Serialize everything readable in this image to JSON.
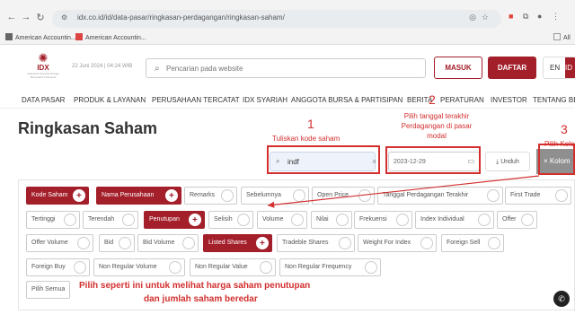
{
  "browser": {
    "url": "idx.co.id/id/data-pasar/ringkasan-perdagangan/ringkasan-saham/",
    "bookmarks": [
      "American Accountin...",
      "American Accountin..."
    ],
    "all_bookmarks": "All"
  },
  "header": {
    "logo_text": "IDX",
    "logo_sub": "Indonesia Stock Exchange Bursa Efek Indonesia",
    "date": "22 Juni 2024",
    "time": "04:24 WIB",
    "search_placeholder": "Pencarian pada website",
    "masuk": "MASUK",
    "daftar": "DAFTAR",
    "lang_en": "EN",
    "lang_id": "ID"
  },
  "nav": [
    "DATA PASAR",
    "PRODUK & LAYANAN",
    "PERUSAHAAN TERCATAT",
    "IDX SYARIAH",
    "ANGGOTA BURSA & PARTISIPAN",
    "BERITA",
    "PERATURAN",
    "INVESTOR",
    "TENTANG BEI"
  ],
  "page_title": "Ringkasan Saham",
  "annotations": {
    "n1": "1",
    "n1_text": "Tuliskan kode saham",
    "n2": "2",
    "n2_text_1": "Pilih tanggal terakhir",
    "n2_text_2": "Perdagangan di pasar",
    "n2_text_3": "modal",
    "n3": "3",
    "n3_text": "Pilih Kolom",
    "bottom_1": "Pilih seperti ini untuk melihat harga saham penutupan",
    "bottom_2": "dan jumlah saham beredar"
  },
  "filters": {
    "code_value": "indf",
    "date_value": "2023-12-29",
    "unduh": "Unduh",
    "kolom": "Kolom"
  },
  "columns": [
    {
      "label": "Kode Saham",
      "selected": true
    },
    {
      "label": "Nama Perusahaan",
      "selected": true
    },
    {
      "label": "Remarks",
      "selected": false
    },
    {
      "label": "Sebelumnya",
      "selected": false
    },
    {
      "label": "Open Price",
      "selected": false
    },
    {
      "label": "Tanggal Perdagangan Terakhir",
      "selected": false
    },
    {
      "label": "First Trade",
      "selected": false
    },
    {
      "label": "Tertinggi",
      "selected": false
    },
    {
      "label": "Terendah",
      "selected": false
    },
    {
      "label": "Penutupan",
      "selected": true
    },
    {
      "label": "Selisih",
      "selected": false
    },
    {
      "label": "Volume",
      "selected": false
    },
    {
      "label": "Nilai",
      "selected": false
    },
    {
      "label": "Frekuensi",
      "selected": false
    },
    {
      "label": "Index Individual",
      "selected": false
    },
    {
      "label": "Offer",
      "selected": false
    },
    {
      "label": "Offer Volume",
      "selected": false
    },
    {
      "label": "Bid",
      "selected": false
    },
    {
      "label": "Bid Volume",
      "selected": false
    },
    {
      "label": "Listed Shares",
      "selected": true
    },
    {
      "label": "Tradeble Shares",
      "selected": false
    },
    {
      "label": "Weight For Index",
      "selected": false
    },
    {
      "label": "Foreign Sell",
      "selected": false
    },
    {
      "label": "Foreign Buy",
      "selected": false
    },
    {
      "label": "Non Regular Volume",
      "selected": false
    },
    {
      "label": "Non Regular Value",
      "selected": false
    },
    {
      "label": "Non Regular Frequency",
      "selected": false
    }
  ],
  "pilih_semua": "Pilih Semua"
}
